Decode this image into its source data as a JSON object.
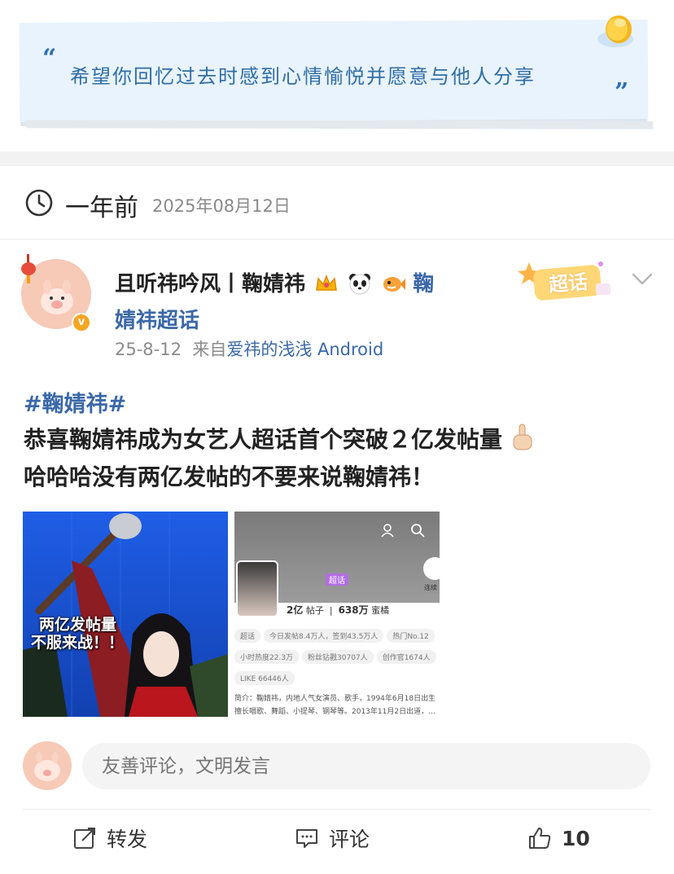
{
  "banner": {
    "quote_open": "“",
    "quote_text": "希望你回忆过去时感到心情愉悦并愿意与他人分享",
    "quote_close": "”"
  },
  "timeline": {
    "relative": "一年前",
    "date": "2025年08月12日"
  },
  "post": {
    "username_line1": "且听祎吟风丨鞠婧祎",
    "username_topic_tail": "鞠",
    "username_line2": "婧祎超话",
    "date": "25-8-12",
    "source_prefix": "来自",
    "source_name": "爱祎的浅浅 Android",
    "supertopic_badge": "超话",
    "verified_badge": "v",
    "hashtag": "#鞠婧祎#",
    "line1": "恭喜鞠婧祎成为女艺人超话首个突破２亿发帖量",
    "line2": "哈哈哈没有两亿发帖的不要来说鞠婧祎！",
    "image1_caption_1": "两亿发帖量",
    "image1_caption_2": "不服来战！！",
    "image2": {
      "tag": "超话",
      "posts_value": "2亿",
      "posts_label": "帖子",
      "fans_value": "638万",
      "fans_label": "蜜橘",
      "chip1": "超话",
      "chip2": "今日发帖8.4万人，签到43.5万人",
      "chip3": "热门No.12",
      "chip4": "小时热度22.3万",
      "chip5": "粉丝钻戳30707人",
      "chip6": "创作官1674人",
      "chip7": "LIKE 66446人",
      "desc1": "简介：鞠婧祎，内地人气女演员、歌手，1994年6月18日出生",
      "desc2": "擅长唱歌、舞蹈、小提琴、钢琴等。2013年11月2日出道，…",
      "fab_label": "连续"
    }
  },
  "comment": {
    "placeholder": "友善评论，文明发言"
  },
  "actions": {
    "repost_label": "转发",
    "comment_label": "评论",
    "like_count": "10"
  },
  "colors": {
    "link_blue": "#3b68a8",
    "quote_blue": "#2f6ea6",
    "banner_bg": "#e9f3fd",
    "meta_gray": "#8a8a8a"
  }
}
